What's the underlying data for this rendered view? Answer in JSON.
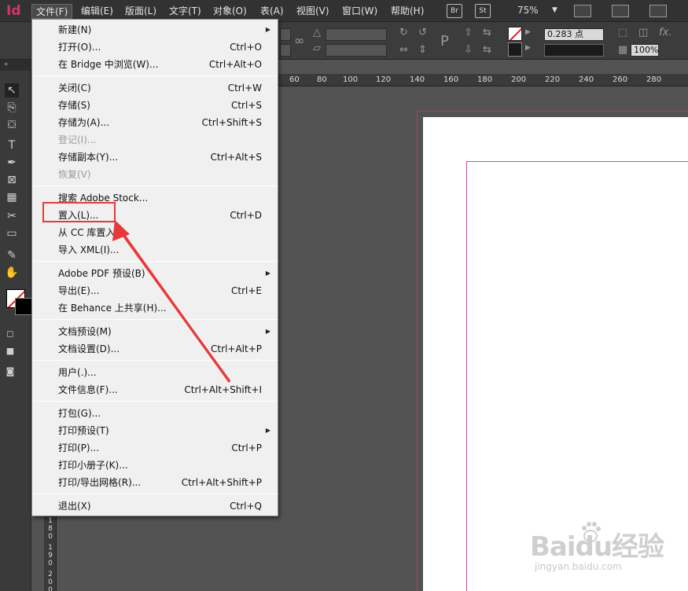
{
  "app": {
    "logo": "Id"
  },
  "menubar": {
    "items": [
      {
        "label": "文件(F)"
      },
      {
        "label": "编辑(E)"
      },
      {
        "label": "版面(L)"
      },
      {
        "label": "文字(T)"
      },
      {
        "label": "对象(O)"
      },
      {
        "label": "表(A)"
      },
      {
        "label": "视图(V)"
      },
      {
        "label": "窗口(W)"
      },
      {
        "label": "帮助(H)"
      }
    ],
    "bridge_badge": "Br",
    "stock_badge": "St",
    "zoom": "75%"
  },
  "controlbar": {
    "stroke_weight": "0.283 点",
    "opacity": "100%"
  },
  "ruler": {
    "h_labels": [
      "60",
      "80",
      "100",
      "120",
      "140",
      "160",
      "180",
      "200",
      "220",
      "240",
      "260",
      "280"
    ],
    "v_labels": [
      "1",
      "8",
      "0",
      "1",
      "9",
      "0",
      "2",
      "0",
      "0"
    ]
  },
  "file_menu": {
    "groups": [
      [
        {
          "label": "新建(N)",
          "shortcut": "",
          "submenu": true,
          "disabled": false
        },
        {
          "label": "打开(O)...",
          "shortcut": "Ctrl+O",
          "submenu": false,
          "disabled": false
        },
        {
          "label": "在 Bridge 中浏览(W)...",
          "shortcut": "Ctrl+Alt+O",
          "submenu": false,
          "disabled": false
        }
      ],
      [
        {
          "label": "关闭(C)",
          "shortcut": "Ctrl+W",
          "submenu": false,
          "disabled": false
        },
        {
          "label": "存储(S)",
          "shortcut": "Ctrl+S",
          "submenu": false,
          "disabled": false
        },
        {
          "label": "存储为(A)...",
          "shortcut": "Ctrl+Shift+S",
          "submenu": false,
          "disabled": false
        },
        {
          "label": "登记(I)...",
          "shortcut": "",
          "submenu": false,
          "disabled": true
        },
        {
          "label": "存储副本(Y)...",
          "shortcut": "Ctrl+Alt+S",
          "submenu": false,
          "disabled": false
        },
        {
          "label": "恢复(V)",
          "shortcut": "",
          "submenu": false,
          "disabled": true
        }
      ],
      [
        {
          "label": "搜索 Adobe Stock...",
          "shortcut": "",
          "submenu": false,
          "disabled": false
        },
        {
          "label": "置入(L)...",
          "shortcut": "Ctrl+D",
          "submenu": false,
          "disabled": false
        },
        {
          "label": "从 CC 库置入...",
          "shortcut": "",
          "submenu": false,
          "disabled": false
        },
        {
          "label": "导入 XML(I)...",
          "shortcut": "",
          "submenu": false,
          "disabled": false
        }
      ],
      [
        {
          "label": "Adobe PDF 预设(B)",
          "shortcut": "",
          "submenu": true,
          "disabled": false
        },
        {
          "label": "导出(E)...",
          "shortcut": "Ctrl+E",
          "submenu": false,
          "disabled": false
        },
        {
          "label": "在 Behance 上共享(H)...",
          "shortcut": "",
          "submenu": false,
          "disabled": false
        }
      ],
      [
        {
          "label": "文档预设(M)",
          "shortcut": "",
          "submenu": true,
          "disabled": false
        },
        {
          "label": "文档设置(D)...",
          "shortcut": "Ctrl+Alt+P",
          "submenu": false,
          "disabled": false
        }
      ],
      [
        {
          "label": "用户(.)...",
          "shortcut": "",
          "submenu": false,
          "disabled": false
        },
        {
          "label": "文件信息(F)...",
          "shortcut": "Ctrl+Alt+Shift+I",
          "submenu": false,
          "disabled": false
        }
      ],
      [
        {
          "label": "打包(G)...",
          "shortcut": "",
          "submenu": false,
          "disabled": false
        },
        {
          "label": "打印预设(T)",
          "shortcut": "",
          "submenu": true,
          "disabled": false
        },
        {
          "label": "打印(P)...",
          "shortcut": "Ctrl+P",
          "submenu": false,
          "disabled": false
        },
        {
          "label": "打印小册子(K)...",
          "shortcut": "",
          "submenu": false,
          "disabled": false
        },
        {
          "label": "打印/导出网格(R)...",
          "shortcut": "Ctrl+Alt+Shift+P",
          "submenu": false,
          "disabled": false
        }
      ],
      [
        {
          "label": "退出(X)",
          "shortcut": "Ctrl+Q",
          "submenu": false,
          "disabled": false
        }
      ]
    ]
  },
  "watermark": {
    "logo": "Baidu经验",
    "url": "jingyan.baidu.com"
  },
  "colors": {
    "accent": "#d6336c",
    "annotation": "#e8383a",
    "menu_bg": "#f0f0f0",
    "ui_dark": "#323232"
  }
}
